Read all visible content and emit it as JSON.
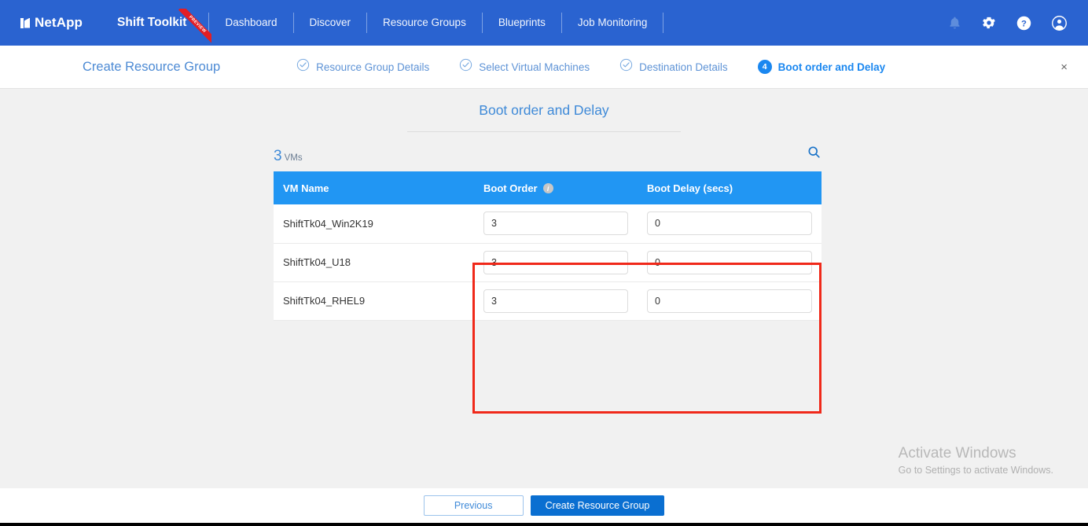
{
  "topnav": {
    "brand": "NetApp",
    "product": "Shift Toolkit",
    "product_badge": "PREVIEW",
    "links": [
      {
        "label": "Dashboard"
      },
      {
        "label": "Discover"
      },
      {
        "label": "Resource Groups"
      },
      {
        "label": "Blueprints"
      },
      {
        "label": "Job Monitoring"
      }
    ],
    "icons": [
      {
        "name": "notification-bell-icon"
      },
      {
        "name": "settings-gear-icon"
      },
      {
        "name": "help-icon"
      },
      {
        "name": "user-account-icon"
      }
    ],
    "background": "#2a63d0"
  },
  "wizard": {
    "title": "Create Resource Group",
    "close_label": "×",
    "steps": [
      {
        "label": "Resource Group Details",
        "state": "complete",
        "marker": "check"
      },
      {
        "label": "Select Virtual Machines",
        "state": "complete",
        "marker": "check"
      },
      {
        "label": "Destination Details",
        "state": "complete",
        "marker": "check"
      },
      {
        "label": "Boot order and Delay",
        "state": "active",
        "marker": "4"
      }
    ]
  },
  "main": {
    "page_title": "Boot order and Delay",
    "count_number": "3",
    "count_label": "VMs",
    "search_icon": "search-icon",
    "table": {
      "columns": [
        {
          "key": "name",
          "label": "VM Name"
        },
        {
          "key": "order",
          "label": "Boot Order",
          "info": "i"
        },
        {
          "key": "delay",
          "label": "Boot Delay (secs)"
        }
      ],
      "rows": [
        {
          "name": "ShiftTk04_Win2K19",
          "order": "3",
          "delay": "0"
        },
        {
          "name": "ShiftTk04_U18",
          "order": "3",
          "delay": "0"
        },
        {
          "name": "ShiftTk04_RHEL9",
          "order": "3",
          "delay": "0"
        }
      ]
    },
    "annotation_color": "#f0291a",
    "header_color": "#2196f3"
  },
  "watermark": {
    "line1": "Activate Windows",
    "line2": "Go to Settings to activate Windows."
  },
  "footer": {
    "previous_label": "Previous",
    "submit_label": "Create Resource Group"
  }
}
